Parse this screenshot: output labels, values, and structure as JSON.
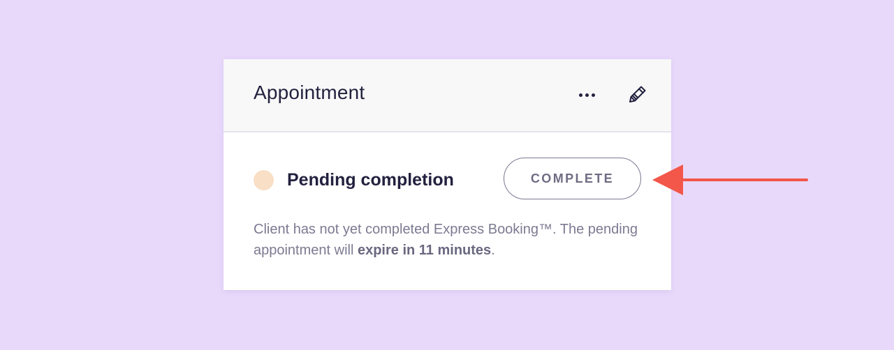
{
  "card": {
    "title": "Appointment",
    "more_icon": "more-horizontal-icon",
    "edit_icon": "pencil-icon"
  },
  "status": {
    "label": "Pending completion",
    "dot_color": "#f9dfc5"
  },
  "actions": {
    "complete_label": "COMPLETE"
  },
  "description": {
    "text_before": "Client has not yet completed Express Booking™. The pending appointment will ",
    "text_bold": "expire in 11 minutes",
    "text_after": "."
  },
  "annotation": {
    "arrow_color": "#f2574a"
  },
  "colors": {
    "background": "#e8d9fb",
    "card": "#ffffff",
    "header": "#f8f8f8",
    "title_text": "#23213f",
    "muted_text": "#7c7a91"
  }
}
